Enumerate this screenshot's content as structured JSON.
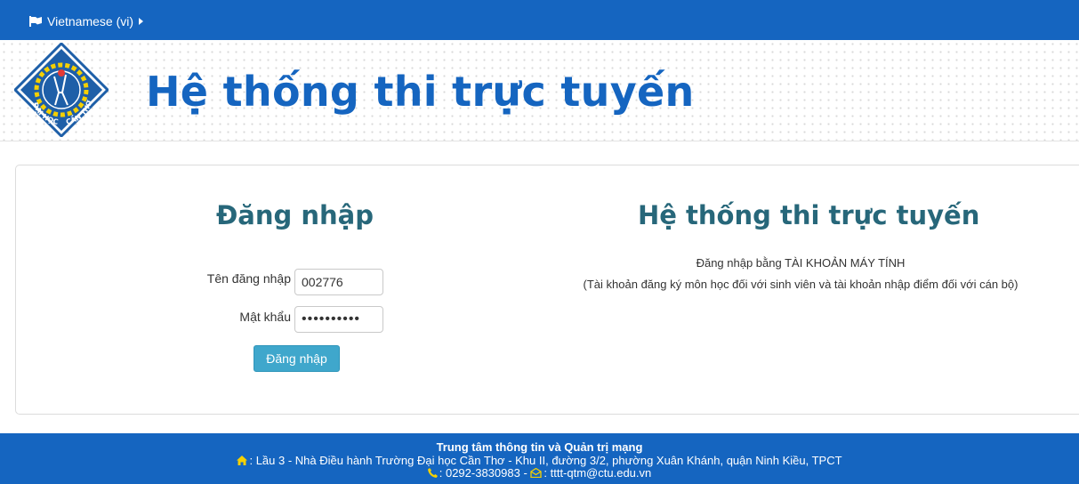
{
  "topbar": {
    "language_label": "Vietnamese (vi)"
  },
  "header": {
    "logo_text": "ĐẠI HỌC CẦN THƠ",
    "site_title": "Hệ thống thi trực tuyến"
  },
  "login": {
    "title": "Đăng nhập",
    "username_label": "Tên đăng nhập",
    "username_value": "002776",
    "password_label": "Mật khẩu",
    "password_value": "••••••••••",
    "submit_label": "Đăng nhập"
  },
  "info": {
    "title": "Hệ thống thi trực tuyến",
    "line1": "Đăng nhập bằng TÀI KHOẢN MÁY TÍNH",
    "line2": "(Tài khoản đăng ký môn học đối với sinh viên và tài khoản nhập điểm đối với cán bộ)"
  },
  "footer": {
    "org": "Trung tâm thông tin và Quản trị mạng",
    "address": ": Lầu 3 - Nhà Điều hành Trường Đại học Cần Thơ - Khu II, đường 3/2, phường Xuân Khánh, quận Ninh Kiều, TPCT",
    "phone": ": 0292-3830983 - ",
    "email": ": tttt-qtm@ctu.edu.vn"
  },
  "colors": {
    "brand_blue": "#1565c0",
    "heading_teal": "#27677a",
    "button": "#3fa7cc",
    "icon_yellow": "#f5d000"
  },
  "icons": [
    "flag-icon",
    "caret-right-icon",
    "home-icon",
    "phone-icon",
    "envelope-icon"
  ]
}
